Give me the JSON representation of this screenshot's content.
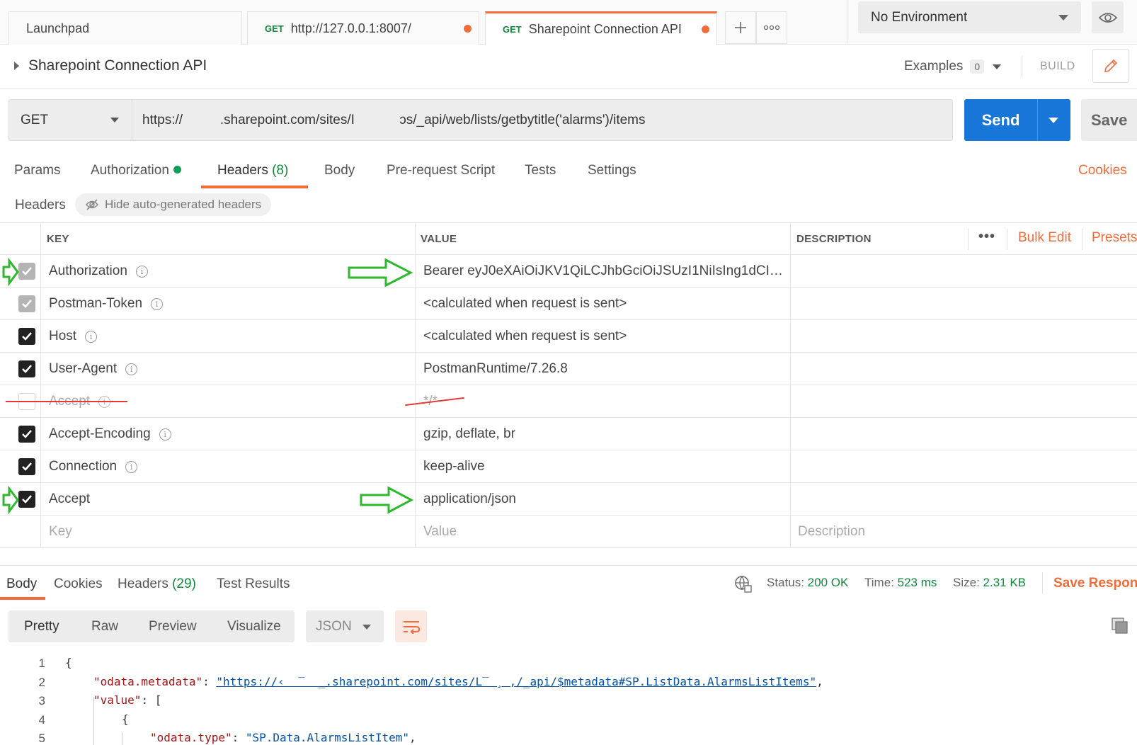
{
  "tabs": [
    {
      "label": "Launchpad",
      "method": ""
    },
    {
      "label": "http://127.0.0.1:8007/",
      "method": "GET"
    },
    {
      "label": "Sharepoint Connection API",
      "method": "GET"
    }
  ],
  "environment": {
    "selected": "No Environment"
  },
  "request": {
    "title": "Sharepoint Connection API",
    "examples_label": "Examples",
    "examples_count": "0",
    "build_label": "BUILD",
    "method": "GET",
    "url": "https://          .sharepoint.com/sites/I            ɔs/_api/web/lists/getbytitle('alarms')/items",
    "send_label": "Send",
    "save_label": "Save"
  },
  "request_tabs": {
    "params": "Params",
    "authorization": "Authorization",
    "headers": "Headers",
    "headers_count": "(8)",
    "body": "Body",
    "prerequest": "Pre-request Script",
    "tests": "Tests",
    "settings": "Settings",
    "cookies": "Cookies"
  },
  "headers_section": {
    "label": "Headers",
    "hide_button": "Hide auto-generated headers",
    "col_key": "KEY",
    "col_value": "VALUE",
    "col_description": "DESCRIPTION",
    "bulk_edit": "Bulk Edit",
    "presets": "Presets",
    "rows": [
      {
        "key": "Authorization",
        "value": "Bearer eyJ0eXAiOiJKV1QiLCJhbGciOiJSUzI1NiIsIng1dCI6IjJaU...",
        "state": "grey"
      },
      {
        "key": "Postman-Token",
        "value": "<calculated when request is sent>",
        "state": "grey"
      },
      {
        "key": "Host",
        "value": "<calculated when request is sent>",
        "state": "on"
      },
      {
        "key": "User-Agent",
        "value": "PostmanRuntime/7.26.8",
        "state": "on"
      },
      {
        "key": "Accept",
        "value": "*/*",
        "state": "off"
      },
      {
        "key": "Accept-Encoding",
        "value": "gzip, deflate, br",
        "state": "on"
      },
      {
        "key": "Connection",
        "value": "keep-alive",
        "state": "on"
      },
      {
        "key": "Accept",
        "value": "application/json",
        "state": "on"
      }
    ],
    "placeholder_key": "Key",
    "placeholder_value": "Value",
    "placeholder_description": "Description"
  },
  "response": {
    "tabs": {
      "body": "Body",
      "cookies": "Cookies",
      "headers": "Headers",
      "headers_count": "(29)",
      "test_results": "Test Results"
    },
    "status_label": "Status:",
    "status_value": "200 OK",
    "time_label": "Time:",
    "time_value": "523 ms",
    "size_label": "Size:",
    "size_value": "2.31 KB",
    "save_response": "Save Respons",
    "views": [
      "Pretty",
      "Raw",
      "Preview",
      "Visualize"
    ],
    "format": "JSON",
    "code": {
      "line_numbers": [
        "1",
        "2",
        "3",
        "4",
        "5"
      ],
      "line1": "{",
      "metadata_key": "\"odata.metadata\"",
      "metadata_value": "\"https://‹  ‾  _.sharepoint.com/sites/L‾ ¸ ,/_api/$metadata#SP.ListData.AlarmsListItems\"",
      "value_key": "\"value\"",
      "line3_rest": ": [",
      "line4": "{",
      "type_key": "\"odata.type\"",
      "type_value": "\"SP.Data.AlarmsListItem\""
    }
  },
  "colors": {
    "accent": "#f26b3a",
    "send": "#1976d9",
    "success": "#0f8a3c",
    "annotation_arrow": "#2eb82e"
  }
}
